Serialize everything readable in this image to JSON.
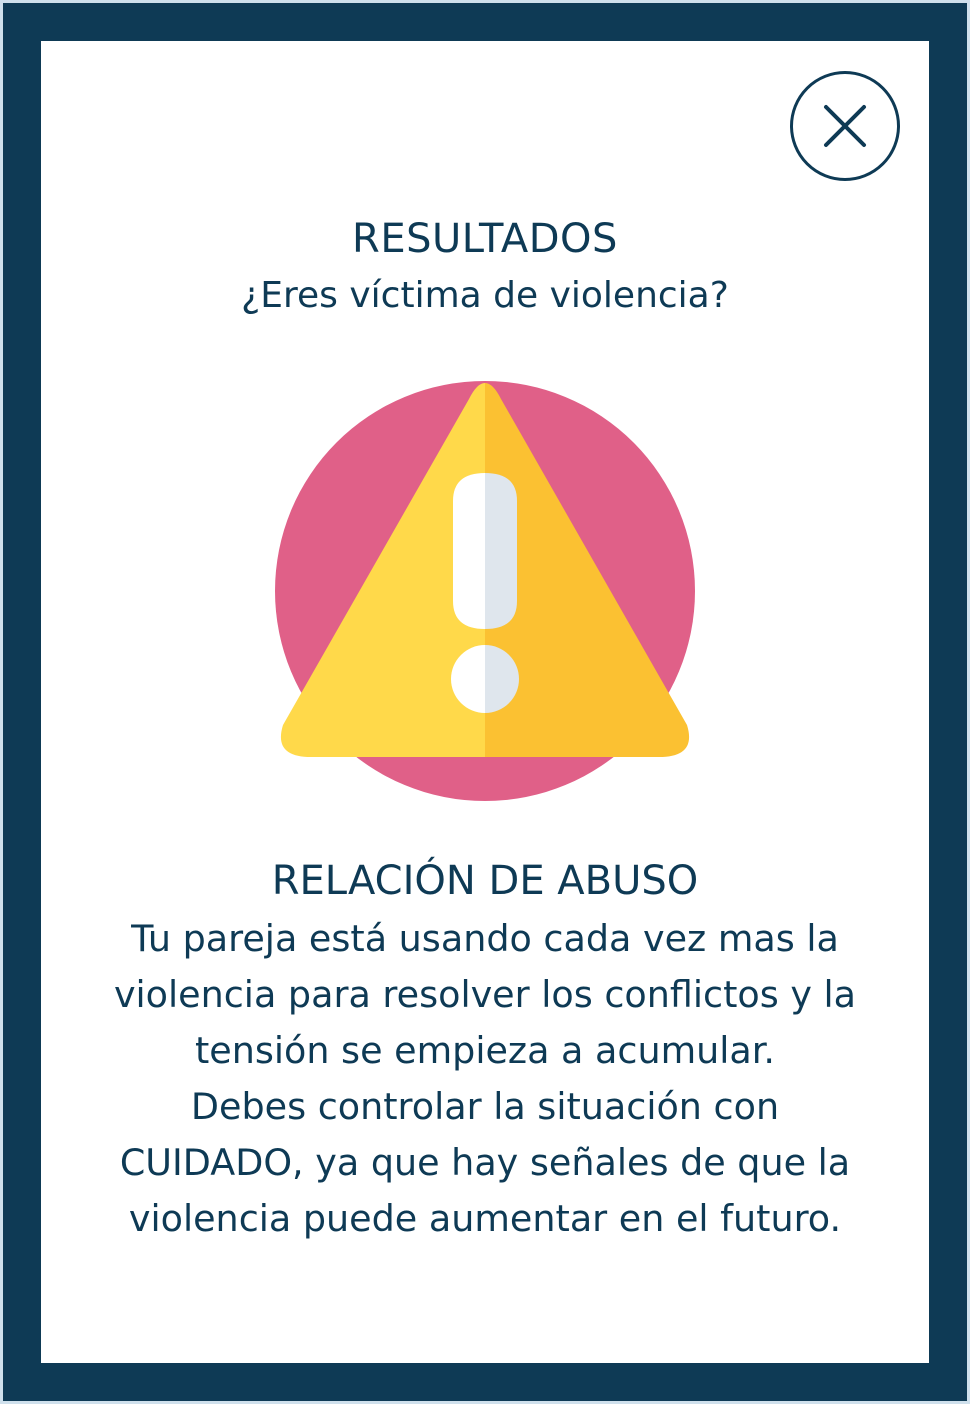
{
  "modal": {
    "close_icon": "close-icon",
    "title": "RESULTADOS",
    "subtitle": "¿Eres víctima de violencia?",
    "illustration_icon": "warning-triangle-icon",
    "result_heading": "RELACIÓN DE ABUSO",
    "result_lines": [
      "Tu pareja está usando cada vez mas la",
      "violencia para resolver los conflictos y la",
      "tensión se empieza a acumular.",
      "Debes controlar la situación con",
      "CUIDADO, ya que hay señales de que la",
      "violencia puede aumentar en el futuro."
    ]
  },
  "colors": {
    "frame": "#0e3a55",
    "card": "#ffffff",
    "text": "#0e3a55",
    "circle": "#e06088",
    "triangle_left": "#ffd94a",
    "triangle_right": "#fbc132",
    "mark_left": "#ffffff",
    "mark_right": "#dfe6ed"
  }
}
